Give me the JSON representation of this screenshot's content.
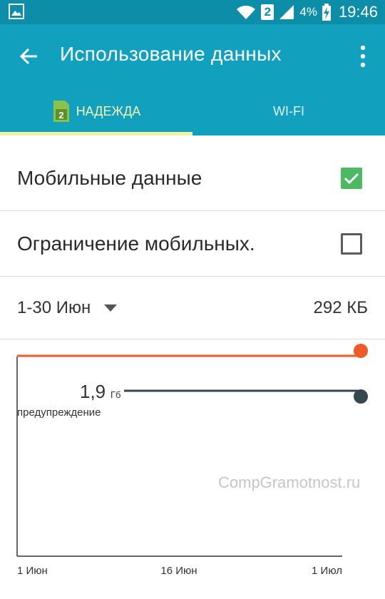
{
  "status_bar": {
    "sim_slot": "2",
    "battery": "4%",
    "time": "19:46"
  },
  "app_bar": {
    "title": "Использование данных"
  },
  "tabs": [
    {
      "label": "НАДЕЖДА",
      "sim": "2",
      "active": true
    },
    {
      "label": "WI-FI",
      "active": false
    }
  ],
  "settings": {
    "mobile_data": {
      "label": "Мобильные данные",
      "checked": true
    },
    "limit_mobile": {
      "label": "Ограничение мобильных.",
      "checked": false
    }
  },
  "period": {
    "range": "1-30 Июн",
    "total": "292 КБ"
  },
  "chart_data": {
    "type": "line",
    "x_labels": [
      "1 Июн",
      "16 Июн",
      "1 Июл"
    ],
    "warning": {
      "value": "1,9",
      "unit": "Гб",
      "label": "предупреждение"
    },
    "limit_color": "#f05a28",
    "warning_color": "#37474f"
  },
  "watermark": "CompGramotnost.ru",
  "colors": {
    "status_bar": "#0c8ea8",
    "app_bar": "#12a0bf",
    "tab_active": "#f3f7b0",
    "check_on": "#4cb963"
  }
}
